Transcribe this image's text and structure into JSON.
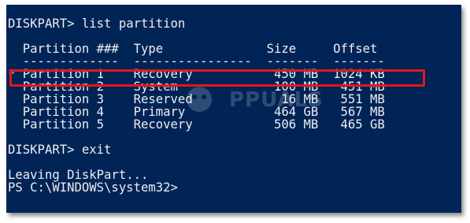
{
  "terminal": {
    "background": "#012456",
    "text_color": "#eeedf0",
    "highlight_color": "#e0191d",
    "lines": [
      "DISKPART> list partition",
      "",
      "  Partition ###  Type              Size     Offset",
      "  -------------  ----------------  -------  -------",
      "* Partition 1    Recovery           450 MB  1024 KB",
      "  Partition 2    System             100 MB   451 MB",
      "  Partition 3    Reserved            16 MB   551 MB",
      "  Partition 4    Primary            464 GB   567 MB",
      "  Partition 5    Recovery           506 MB   465 GB",
      "",
      "DISKPART> exit",
      "",
      "Leaving DiskPart...",
      "PS C:\\WINDOWS\\system32>"
    ]
  },
  "watermark": {
    "text": "PPUALS"
  }
}
